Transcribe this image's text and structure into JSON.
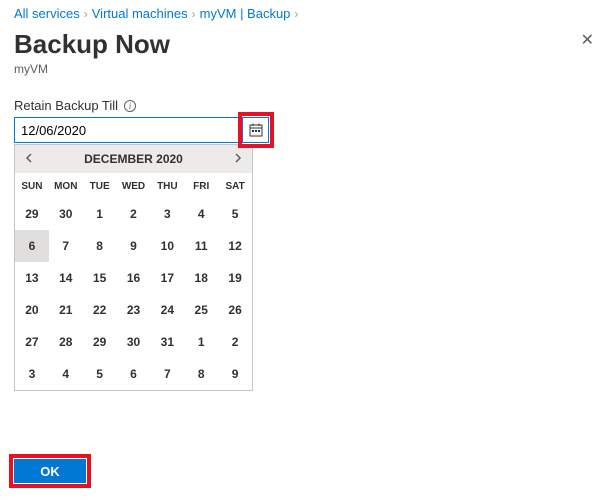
{
  "breadcrumb": {
    "items": [
      {
        "label": "All services"
      },
      {
        "label": "Virtual machines"
      },
      {
        "label": "myVM | Backup"
      }
    ]
  },
  "header": {
    "title": "Backup Now",
    "subtitle": "myVM"
  },
  "field": {
    "label": "Retain Backup Till",
    "value": "12/06/2020"
  },
  "calendar": {
    "month_label": "DECEMBER 2020",
    "dow": [
      "SUN",
      "MON",
      "TUE",
      "WED",
      "THU",
      "FRI",
      "SAT"
    ],
    "days": [
      {
        "n": "29",
        "muted": true
      },
      {
        "n": "30",
        "muted": true
      },
      {
        "n": "1"
      },
      {
        "n": "2"
      },
      {
        "n": "3"
      },
      {
        "n": "4"
      },
      {
        "n": "5"
      },
      {
        "n": "6",
        "selected": true
      },
      {
        "n": "7"
      },
      {
        "n": "8"
      },
      {
        "n": "9"
      },
      {
        "n": "10"
      },
      {
        "n": "11"
      },
      {
        "n": "12"
      },
      {
        "n": "13"
      },
      {
        "n": "14"
      },
      {
        "n": "15"
      },
      {
        "n": "16"
      },
      {
        "n": "17"
      },
      {
        "n": "18"
      },
      {
        "n": "19"
      },
      {
        "n": "20"
      },
      {
        "n": "21"
      },
      {
        "n": "22"
      },
      {
        "n": "23"
      },
      {
        "n": "24"
      },
      {
        "n": "25"
      },
      {
        "n": "26"
      },
      {
        "n": "27"
      },
      {
        "n": "28"
      },
      {
        "n": "29"
      },
      {
        "n": "30"
      },
      {
        "n": "31"
      },
      {
        "n": "1",
        "muted": true
      },
      {
        "n": "2",
        "muted": true
      },
      {
        "n": "3",
        "muted": true
      },
      {
        "n": "4",
        "muted": true
      },
      {
        "n": "5",
        "muted": true
      },
      {
        "n": "6",
        "muted": true
      },
      {
        "n": "7",
        "muted": true
      },
      {
        "n": "8",
        "muted": true
      },
      {
        "n": "9",
        "muted": true
      }
    ]
  },
  "footer": {
    "ok_label": "OK"
  }
}
